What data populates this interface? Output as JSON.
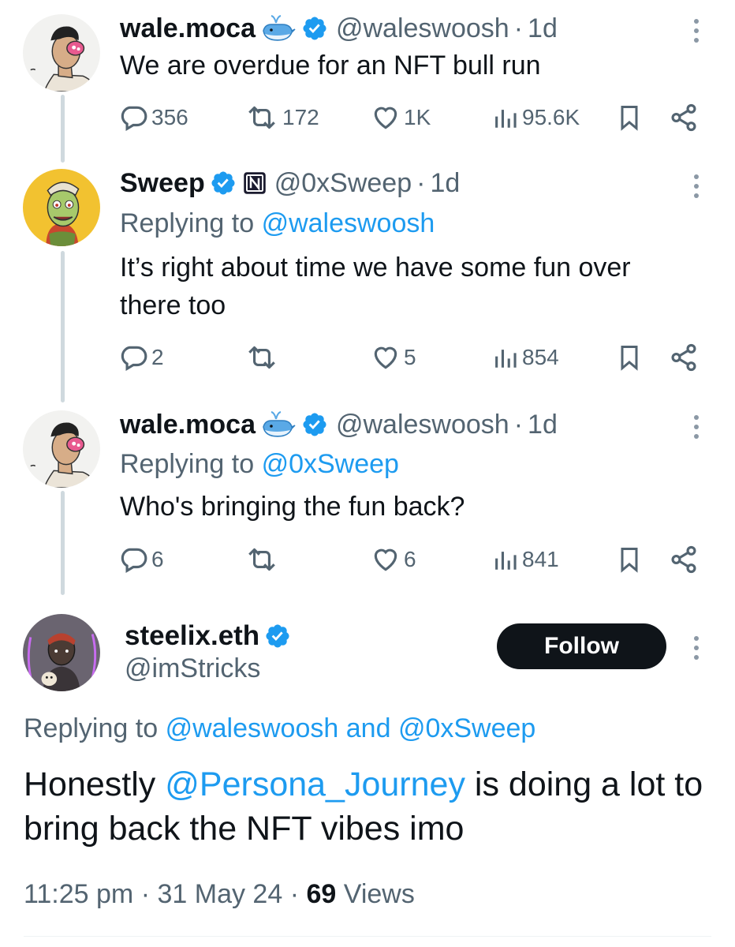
{
  "tweets": [
    {
      "author": {
        "name": "wale.moca",
        "handle": "@waleswoosh",
        "verified": true,
        "extra_badge": "whale-emoji"
      },
      "time": "1d",
      "replying_to": null,
      "text": "We are overdue for an NFT bull run",
      "stats": {
        "replies": "356",
        "reposts": "172",
        "likes": "1K",
        "views": "95.6K"
      }
    },
    {
      "author": {
        "name": "Sweep",
        "handle": "@0xSweep",
        "verified": true,
        "extra_badge": "nft-square-badge"
      },
      "time": "1d",
      "replying_label": "Replying to",
      "replying_to": "@waleswoosh",
      "text": "It’s right about time we have some fun over there too",
      "stats": {
        "replies": "2",
        "reposts": "",
        "likes": "5",
        "views": "854"
      }
    },
    {
      "author": {
        "name": "wale.moca",
        "handle": "@waleswoosh",
        "verified": true,
        "extra_badge": "whale-emoji"
      },
      "time": "1d",
      "replying_label": "Replying to",
      "replying_to": "@0xSweep",
      "text": "Who's bringing the fun back?",
      "stats": {
        "replies": "6",
        "reposts": "",
        "likes": "6",
        "views": "841"
      }
    }
  ],
  "focused": {
    "author": {
      "name": "steelix.eth",
      "handle": "@imStricks",
      "verified": true
    },
    "follow_label": "Follow",
    "replying_label": "Replying to",
    "replying_to_1": "@waleswoosh",
    "replying_and": "and",
    "replying_to_2": "@0xSweep",
    "text_before": "Honestly ",
    "mention": "@Persona_Journey",
    "text_after": " is doing a lot to bring back the NFT vibes imo",
    "time": "11:25 pm",
    "date": "31 May 24",
    "views_count": "69",
    "views_label": "Views"
  },
  "colors": {
    "link": "#1d9bf0",
    "secondary_text": "#536471",
    "verified": "#1d9bf0",
    "follow_button_bg": "#0f1419",
    "thread_line": "#cfd9de"
  },
  "icons": [
    "reply-icon",
    "repost-icon",
    "like-icon",
    "views-icon",
    "bookmark-icon",
    "share-icon",
    "more-icon",
    "verified-icon"
  ]
}
